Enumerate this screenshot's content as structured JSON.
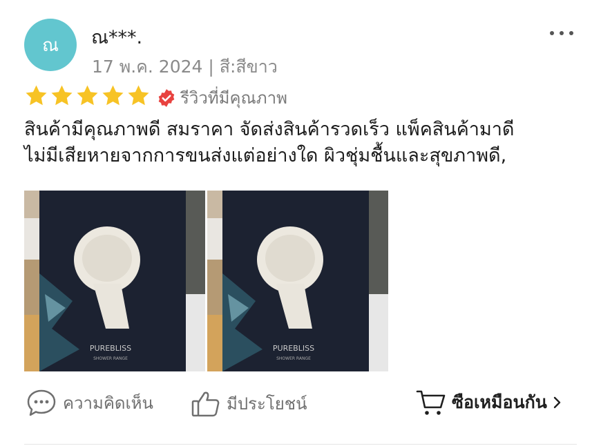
{
  "review": {
    "avatar_letter": "ณ",
    "username": "ณ***.",
    "date_variant": "17 พ.ค. 2024 | สี:สีขาว",
    "rating": 5,
    "quality_badge": "รีวิวที่มีคุณภาพ",
    "text_lines": [
      "สินค้ามีคุณภาพดี สมราคา จัดส่งสินค้ารวดเร็ว แพ็คสินค้ามาดี",
      "ไม่มีเสียหายจากการขนส่งแต่อย่างใด ผิวชุ่มชื้นและสุขภาพดี,"
    ],
    "photos": [
      {
        "box_brand": "PUREBLISS",
        "box_subtitle": "SHOWER RANGE"
      },
      {
        "box_brand": "PUREBLISS",
        "box_subtitle": "SHOWER RANGE"
      }
    ]
  },
  "actions": {
    "comment_label": "ความคิดเห็น",
    "like_label": "มีประโยชน์",
    "buy_label": "ซือเหมือนกัน"
  },
  "icons": {
    "more": "more-dots-icon",
    "star": "star-icon",
    "verified": "verified-badge-icon",
    "comment": "comment-icon",
    "like": "thumbs-up-icon",
    "cart": "cart-icon",
    "chevron": "chevron-right-icon"
  },
  "colors": {
    "avatar": "#62c6cf",
    "star": "#f7c325",
    "verified": "#e8423f",
    "meta_text": "#8a8a8a"
  }
}
